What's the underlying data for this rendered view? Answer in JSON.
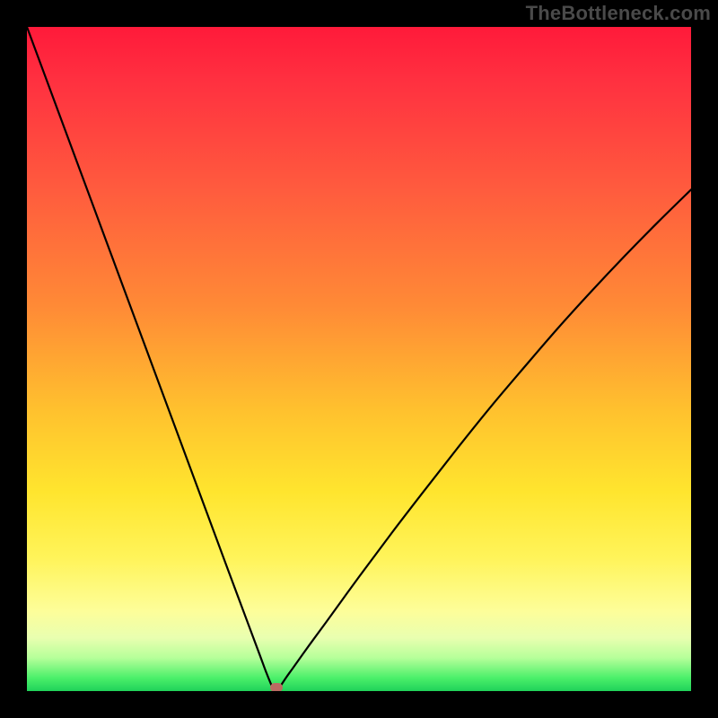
{
  "attribution": "TheBottleneck.com",
  "chart_data": {
    "type": "line",
    "title": "",
    "xlabel": "",
    "ylabel": "",
    "xlim": [
      0,
      100
    ],
    "ylim": [
      0,
      100
    ],
    "grid": false,
    "legend": false,
    "series": [
      {
        "name": "bottleneck-curve",
        "x": [
          0,
          5,
          10,
          15,
          20,
          25,
          30,
          32.5,
          35,
          36,
          37,
          37.5,
          38,
          39,
          40,
          42.5,
          45,
          50,
          55,
          60,
          65,
          70,
          75,
          80,
          85,
          90,
          95,
          100
        ],
        "y": [
          100,
          86.5,
          73,
          59.5,
          46,
          32.5,
          19,
          12.3,
          5.6,
          2.9,
          0.5,
          0,
          0.5,
          2.0,
          3.4,
          6.9,
          10.3,
          17.2,
          23.9,
          30.4,
          36.8,
          43.0,
          48.9,
          54.7,
          60.2,
          65.5,
          70.6,
          75.5
        ]
      }
    ],
    "marker": {
      "x": 37.5,
      "y": 0.5
    },
    "background": {
      "type": "vertical-gradient",
      "stops": [
        {
          "pos": 0,
          "color": "#ff1a3a"
        },
        {
          "pos": 24,
          "color": "#ff5a3e"
        },
        {
          "pos": 58,
          "color": "#ffc22e"
        },
        {
          "pos": 80,
          "color": "#fff45a"
        },
        {
          "pos": 95,
          "color": "#b6ff9a"
        },
        {
          "pos": 100,
          "color": "#1fd25a"
        }
      ]
    }
  }
}
